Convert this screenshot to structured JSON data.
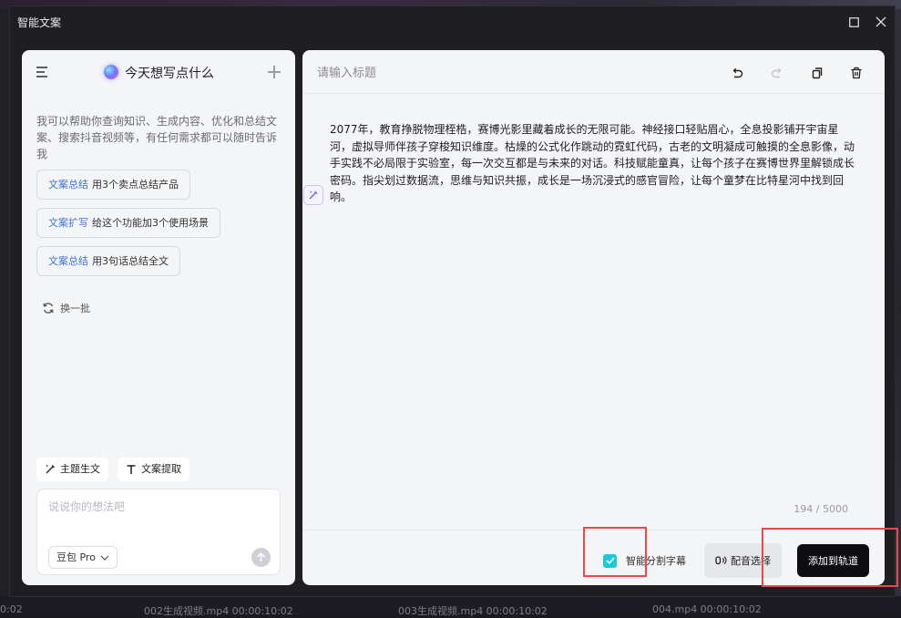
{
  "window": {
    "title": "智能文案"
  },
  "timeline": {
    "clips": [
      {
        "label": "0:02"
      },
      {
        "label": "002生成视频.mp4   00:00:10:02"
      },
      {
        "label": "003生成视频.mp4   00:00:10:02"
      },
      {
        "label": "004.mp4   00:00:10:02"
      }
    ]
  },
  "left_panel": {
    "title": "今天想写点什么",
    "intro": "我可以帮助你查询知识、生成内容、优化和总结文案、搜索抖音视频等，有任何需求都可以随时告诉我",
    "suggestions": [
      {
        "tag": "文案总结",
        "text": "用3个卖点总结产品"
      },
      {
        "tag": "文案扩写",
        "text": "给这个功能加3个使用场景"
      },
      {
        "tag": "文案总结",
        "text": "用3句话总结全文"
      }
    ],
    "refresh_label": "换一批",
    "tools": {
      "topic_label": "主题生文",
      "extract_label": "文案提取"
    },
    "input_placeholder": "说说你的想法吧",
    "model": "豆包 Pro"
  },
  "right_panel": {
    "title_placeholder": "请输入标题",
    "content": "2077年，教育挣脱物理桎梏，赛博光影里藏着成长的无限可能。神经接口轻贴眉心，全息投影铺开宇宙星河，虚拟导师伴孩子穿梭知识维度。枯燥的公式化作跳动的霓虹代码，古老的文明凝成可触摸的全息影像，动手实践不必局限于实验室，每一次交互都是与未来的对话。科技赋能童真，让每个孩子在赛博世界里解锁成长密码。指尖划过数据流，思维与知识共振，成长是一场沉浸式的感官冒险，让每个童梦在比特星河中找到回响。",
    "char_count": "194 / 5000",
    "smart_subtitle_label": "智能分割字幕",
    "smart_subtitle_checked": true,
    "voice_label": "配音选择",
    "add_label": "添加到轨道"
  },
  "colors": {
    "accent_cyan": "#1dc8d8",
    "tag_blue": "#3d73d9",
    "highlight_red": "#e8494a",
    "primary_button": "#0e0e12"
  }
}
